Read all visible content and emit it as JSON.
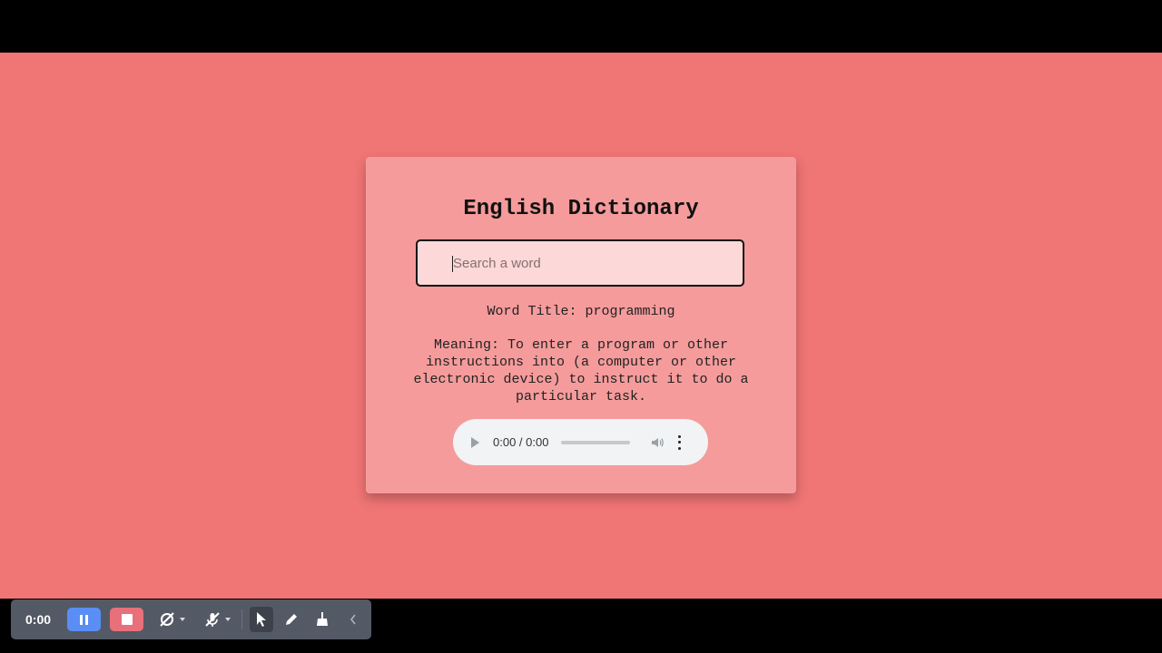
{
  "card": {
    "title": "English Dictionary",
    "search": {
      "placeholder": "Search a word",
      "value": ""
    },
    "word_title": "Word Title: programming",
    "meaning": "Meaning: To enter a program or other instructions into (a computer or other electronic device) to instruct it to do a particular task.",
    "audio": {
      "time": "0:00 / 0:00"
    }
  },
  "toolbar": {
    "timer": "0:00",
    "icons": [
      "pause-icon",
      "stop-icon",
      "camera-off-icon",
      "mic-off-icon",
      "cursor-icon",
      "pen-icon",
      "broom-icon",
      "chevron-left-icon"
    ]
  },
  "colors": {
    "stage_bg": "#f07575",
    "card_bg": "#f59b9b",
    "input_bg": "#fcd8d8",
    "pause_button": "#5b8ef5",
    "stop_button": "#e8707a",
    "toolbar_bg": "#545a65"
  }
}
